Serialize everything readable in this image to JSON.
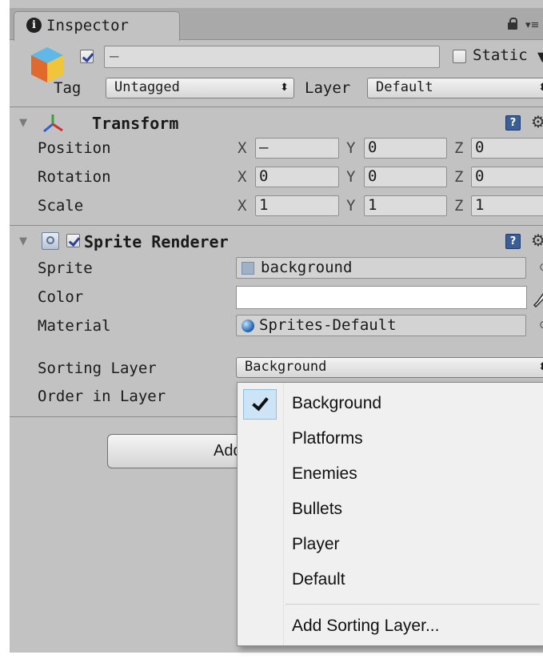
{
  "tab": {
    "label": "Inspector",
    "info_glyph": "i"
  },
  "header": {
    "name_value": "—",
    "static_label": "Static",
    "tag_label": "Tag",
    "tag_value": "Untagged",
    "layer_label": "Layer",
    "layer_value": "Default"
  },
  "transform": {
    "title": "Transform",
    "rows": [
      {
        "label": "Position",
        "x": "—",
        "y": "0",
        "z": "0"
      },
      {
        "label": "Rotation",
        "x": "0",
        "y": "0",
        "z": "0"
      },
      {
        "label": "Scale",
        "x": "1",
        "y": "1",
        "z": "1"
      }
    ],
    "axis_x": "X",
    "axis_y": "Y",
    "axis_z": "Z"
  },
  "sprite_renderer": {
    "title": "Sprite Renderer",
    "sprite_label": "Sprite",
    "sprite_value": "background",
    "color_label": "Color",
    "material_label": "Material",
    "material_value": "Sprites-Default",
    "sorting_layer_label": "Sorting Layer",
    "sorting_layer_value": "Background",
    "order_label": "Order in Layer"
  },
  "add_component_label": "Add Component",
  "sorting_menu": {
    "items": [
      "Background",
      "Platforms",
      "Enemies",
      "Bullets",
      "Player",
      "Default"
    ],
    "selected": "Background",
    "add_label": "Add Sorting Layer..."
  },
  "colors": {
    "panel": "#c2c2c2",
    "help": "#3b5f95",
    "menu_highlight": "#cde4f7"
  }
}
